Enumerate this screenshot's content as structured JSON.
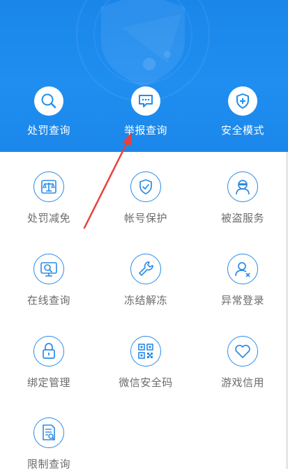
{
  "header": {
    "top_menu": [
      {
        "label": "处罚查询",
        "icon": "search-icon"
      },
      {
        "label": "举报查询",
        "icon": "chat-bubble-icon"
      },
      {
        "label": "安全模式",
        "icon": "shield-plus-icon"
      }
    ]
  },
  "services": [
    {
      "label": "处罚减免",
      "icon": "scales-icon"
    },
    {
      "label": "帐号保护",
      "icon": "shield-check-icon"
    },
    {
      "label": "被盗服务",
      "icon": "thief-icon"
    },
    {
      "label": "在线查询",
      "icon": "monitor-search-icon"
    },
    {
      "label": "冻结解冻",
      "icon": "wrench-icon"
    },
    {
      "label": "异常登录",
      "icon": "user-warning-icon"
    },
    {
      "label": "绑定管理",
      "icon": "lock-icon"
    },
    {
      "label": "微信安全码",
      "icon": "qr-code-icon"
    },
    {
      "label": "游戏信用",
      "icon": "heart-icon"
    },
    {
      "label": "限制查询",
      "icon": "document-search-icon"
    }
  ],
  "colors": {
    "header_bg": "#1f8ef0",
    "icon_accent": "#2a8be6",
    "annotation_arrow": "#e8403a",
    "label_gray": "#6b6b6b"
  }
}
